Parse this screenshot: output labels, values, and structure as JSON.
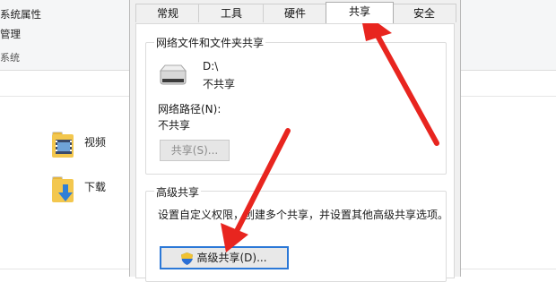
{
  "explorer": {
    "ribbon": {
      "item1": "系统属性",
      "item2": "管理",
      "group": "系统"
    },
    "folders": [
      {
        "label": "视频",
        "icon": "video-folder-icon"
      },
      {
        "label": "下载",
        "icon": "download-folder-icon"
      }
    ]
  },
  "dialog": {
    "tabs": [
      "常规",
      "工具",
      "硬件",
      "共享",
      "安全"
    ],
    "active_tab": "共享",
    "network_share": {
      "title": "网络文件和文件夹共享",
      "drive": "D:\\",
      "drive_status": "不共享",
      "path_label": "网络路径(N):",
      "path_value": "不共享",
      "share_button": "共享(S)..."
    },
    "advanced_share": {
      "title": "高级共享",
      "description": "设置自定义权限，创建多个共享，并设置其他高级共享选项。",
      "button": "高级共享(D)..."
    }
  },
  "colors": {
    "arrow": "#e8251f",
    "focus_border": "#2b78d7"
  }
}
